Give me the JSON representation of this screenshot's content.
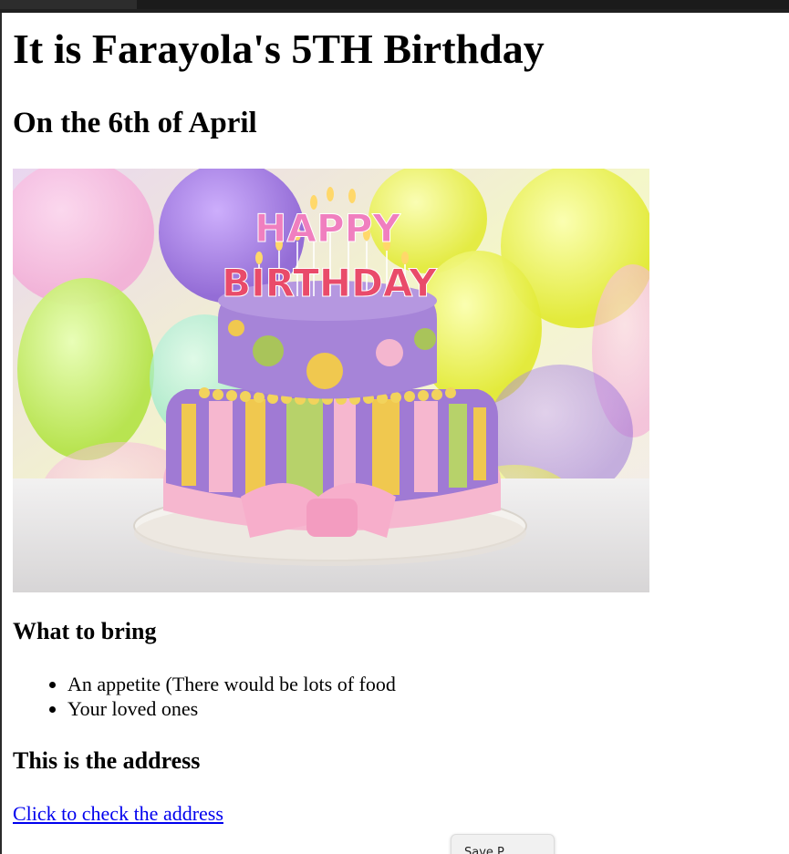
{
  "page": {
    "title": "It is Farayola's 5TH Birthday",
    "subtitle": "On the 6th of April"
  },
  "image": {
    "cake_text_top": "HAPPY",
    "cake_text_bottom": "BIRTHDAY"
  },
  "bring": {
    "heading": "What to bring",
    "items": [
      "An appetite (There would be lots of food",
      "Your loved ones"
    ]
  },
  "address": {
    "heading": "This is the address",
    "link_text": "Click to check the address"
  },
  "floating_button": {
    "label": "Save P"
  },
  "colors": {
    "link": "#0000ee",
    "topbar": "#202020"
  }
}
